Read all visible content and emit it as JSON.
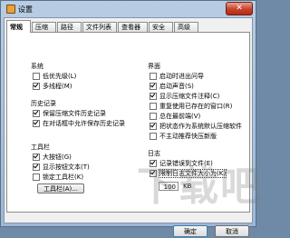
{
  "window": {
    "title": "设置",
    "close_glyph": "✕"
  },
  "tabs": [
    {
      "label": "常规",
      "active": true
    },
    {
      "label": "压缩",
      "active": false
    },
    {
      "label": "路径",
      "active": false
    },
    {
      "label": "文件列表",
      "active": false
    },
    {
      "label": "查看器",
      "active": false
    },
    {
      "label": "安全",
      "active": false
    },
    {
      "label": "高级",
      "active": false
    }
  ],
  "left": {
    "system_title": "系统",
    "system_options": [
      {
        "label": "低优先级(L)",
        "checked": false
      },
      {
        "label": "多线程(M)",
        "checked": true
      }
    ],
    "history_title": "历史记录",
    "history_options": [
      {
        "label": "保留压缩文件历史记录",
        "checked": true
      },
      {
        "label": "在对话框中允许保存历史记录",
        "checked": true
      }
    ],
    "toolbar_title": "工具栏",
    "toolbar_options": [
      {
        "label": "大按钮(G)",
        "checked": true
      },
      {
        "label": "显示按钮文本(T)",
        "checked": true
      },
      {
        "label": "锁定工具栏(K)",
        "checked": false
      }
    ],
    "toolbar_button": "工具栏(A)..."
  },
  "right": {
    "ui_title": "界面",
    "ui_options": [
      {
        "label": "启动时进出问导",
        "checked": false
      },
      {
        "label": "启动声音(S)",
        "checked": true
      },
      {
        "label": "显示压缩文件注释(C)",
        "checked": true
      },
      {
        "label": "重复使用已存在的窗口(R)",
        "checked": false
      },
      {
        "label": "总在最前端(V)",
        "checked": false
      },
      {
        "label": "把状态作为系统默认压缩软件",
        "checked": true
      },
      {
        "label": "不主动推荐快压新版",
        "checked": false
      }
    ],
    "log_title": "日志",
    "log_options": [
      {
        "label": "记录错误到文件(E)",
        "checked": true
      },
      {
        "label": "限制日志文件大小为(K)",
        "checked": true
      }
    ],
    "log_size_value": "100",
    "log_size_unit": "KB"
  },
  "footer": {
    "ok": "确定",
    "cancel": "取消",
    "help": "帮助"
  },
  "watermark": "下载吧"
}
